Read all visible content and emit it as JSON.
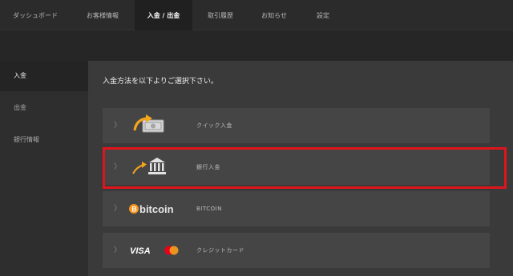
{
  "nav": {
    "tabs": [
      {
        "label": "ダッシュボード"
      },
      {
        "label": "お客様情報"
      },
      {
        "label": "入金 / 出金",
        "active": true
      },
      {
        "label": "取引履歴"
      },
      {
        "label": "お知らせ"
      },
      {
        "label": "設定"
      }
    ]
  },
  "sidebar": {
    "items": [
      {
        "label": "入金",
        "active": true
      },
      {
        "label": "出金"
      },
      {
        "label": "銀行情報"
      }
    ]
  },
  "main": {
    "heading": "入金方法を以下よりご選択下さい。",
    "options": [
      {
        "label": "クイック入金",
        "icon": "cash-transfer-icon"
      },
      {
        "label": "銀行入金",
        "icon": "bank-icon",
        "selected": true
      },
      {
        "label": "BITCOIN",
        "icon": "bitcoin-logo",
        "logo_text": "bitcoin"
      },
      {
        "label": "クレジットカード",
        "icon": "visa-mastercard-logo",
        "logo_text": "VISA"
      }
    ]
  },
  "colors": {
    "highlight": "#e0141b",
    "accent_gold": "#f4a51c",
    "bitcoin_orange": "#f7931a",
    "mastercard_red": "#eb001b",
    "mastercard_yellow": "#f79e1b"
  }
}
